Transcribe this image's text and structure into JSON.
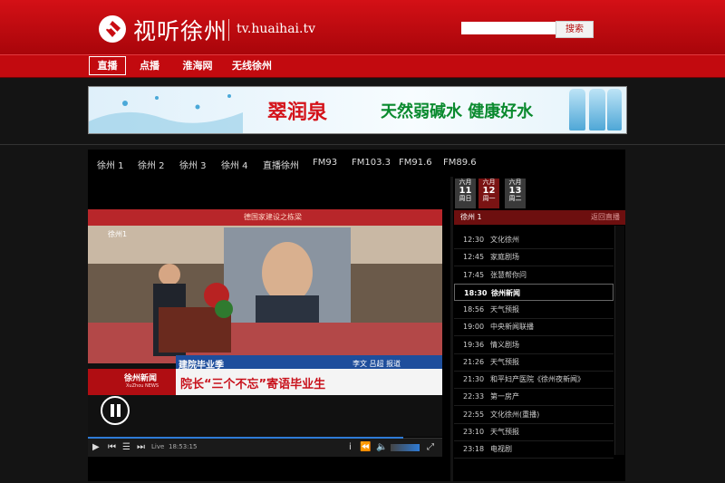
{
  "header": {
    "logo_text": "视听徐州",
    "domain": "tv.huaihai.tv",
    "search_placeholder": "",
    "search_button": "搜索"
  },
  "nav": {
    "items": [
      "直播",
      "点播",
      "淮海网",
      "无线徐州"
    ],
    "active_index": 0
  },
  "banner": {
    "brand": "翠润泉",
    "slogan": "天然弱碱水 健康好水"
  },
  "channels": [
    "徐州 1",
    "徐州 2",
    "徐州 3",
    "徐州 4",
    "直播徐州",
    "FM93",
    "FM103.3",
    "FM91.6",
    "FM89.6"
  ],
  "video": {
    "caption_top": "建院毕业季",
    "caption_reporters": "李文  吕超  报道",
    "caption_main": "院长“三个不忘”寄语毕业生",
    "logo_text": "徐州新闻",
    "logo_sub": "XuZhou NEWS",
    "backdrop_text": "德国家建设之栋梁",
    "station_text": "徐州1",
    "live_label": "Live",
    "time": "18:53:15"
  },
  "schedule": {
    "days": [
      {
        "month": "六月",
        "day": "11",
        "weekday": "周日"
      },
      {
        "month": "六月",
        "day": "12",
        "weekday": "周一"
      },
      {
        "month": "六月",
        "day": "13",
        "weekday": "周二"
      }
    ],
    "active_day_index": 1,
    "channel": "徐州 1",
    "back_live": "返回直播",
    "active_row_index": 3,
    "rows": [
      {
        "time": "12:30",
        "program": "文化徐州"
      },
      {
        "time": "12:45",
        "program": "家庭剧场"
      },
      {
        "time": "17:45",
        "program": "张慧帮你问"
      },
      {
        "time": "18:30",
        "program": "徐州新闻"
      },
      {
        "time": "18:56",
        "program": "天气预报"
      },
      {
        "time": "19:00",
        "program": "中央新闻联播"
      },
      {
        "time": "19:36",
        "program": "情义剧场"
      },
      {
        "time": "21:26",
        "program": "天气预报"
      },
      {
        "time": "21:30",
        "program": "和平妇产医院《徐州夜新闻》"
      },
      {
        "time": "22:33",
        "program": "第一房产"
      },
      {
        "time": "22:55",
        "program": "文化徐州(重播)"
      },
      {
        "time": "23:10",
        "program": "天气预报"
      },
      {
        "time": "23:18",
        "program": "电视剧"
      }
    ]
  }
}
